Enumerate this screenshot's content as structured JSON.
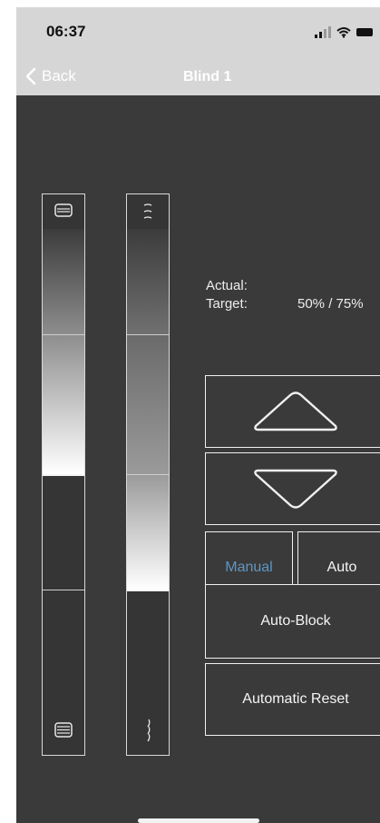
{
  "status_bar": {
    "time": "06:37",
    "icons": [
      "cellular-signal-icon",
      "wifi-icon",
      "battery-icon"
    ]
  },
  "nav": {
    "back_label": "Back",
    "title": "Blind 1"
  },
  "blinds": [
    {
      "name": "blind-position",
      "top_icon": "blind-slats-closed-icon",
      "bottom_icon": "blind-slats-stacked-icon",
      "fill_level_percent": 50
    },
    {
      "name": "blind-tilt",
      "top_icon": "slat-tilt-open-icon",
      "bottom_icon": "slat-tilt-closed-icon",
      "fill_level_percent": 25
    }
  ],
  "info": {
    "actual_label": "Actual:",
    "actual_value": "",
    "target_label": "Target:",
    "target_value": "50% / 75%"
  },
  "controls": {
    "up_icon": "chevron-up-icon",
    "down_icon": "chevron-down-icon",
    "manual_label": "Manual",
    "auto_label": "Auto",
    "auto_block_label": "Auto-Block",
    "automatic_reset_label": "Automatic Reset",
    "active_mode": "Manual"
  },
  "colors": {
    "background": "#3a3a3a",
    "bar": "#d6d6d6",
    "accent": "#5b97c6"
  }
}
